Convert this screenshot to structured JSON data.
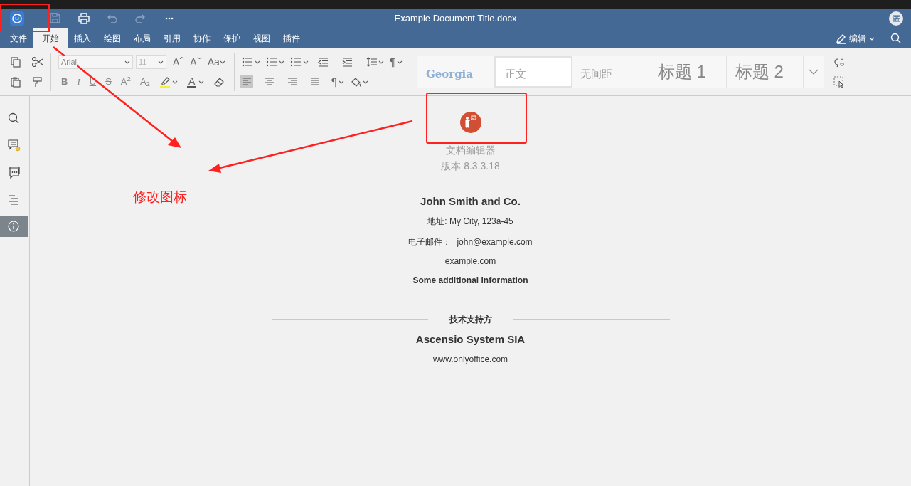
{
  "window": {
    "title": "Example Document Title.docx",
    "avatar": "匿"
  },
  "tabs": [
    {
      "label": "文件",
      "selected": false
    },
    {
      "label": "开始",
      "selected": true
    },
    {
      "label": "插入",
      "selected": false
    },
    {
      "label": "绘图",
      "selected": false
    },
    {
      "label": "布局",
      "selected": false
    },
    {
      "label": "引用",
      "selected": false
    },
    {
      "label": "协作",
      "selected": false
    },
    {
      "label": "保护",
      "selected": false
    },
    {
      "label": "视图",
      "selected": false
    },
    {
      "label": "插件",
      "selected": false
    }
  ],
  "edit_mode": {
    "label": "编辑"
  },
  "toolbar": {
    "font_name": {
      "value": "Arial"
    },
    "font_size": {
      "value": "11"
    },
    "case_buttons": [
      {
        "label": "A",
        "kind": "grow"
      },
      {
        "label": "A",
        "kind": "shrink"
      },
      {
        "label": "Aa",
        "kind": "case"
      }
    ],
    "format_buttons": [
      {
        "label": "B",
        "kind": "bold"
      },
      {
        "label": "I",
        "kind": "italic"
      },
      {
        "label": "U",
        "kind": "underline"
      },
      {
        "label": "S",
        "kind": "strike"
      },
      {
        "label": "A$^{2}$",
        "kind": "plain"
      },
      {
        "label": "A$_{2}$",
        "kind": "plain"
      }
    ],
    "font_color": {
      "label": "A"
    },
    "pilcrows": [
      {
        "label": "¶"
      },
      {
        "label": "¶"
      }
    ],
    "styles": [
      {
        "label": "Georgia",
        "selected": false,
        "kind": "serif"
      },
      {
        "label": "正文",
        "selected": true,
        "kind": "normal"
      },
      {
        "label": "无间距",
        "selected": false,
        "kind": "normal"
      },
      {
        "label": "标题 1",
        "selected": false,
        "kind": "heading"
      },
      {
        "label": "标题 2",
        "selected": false,
        "kind": "heading"
      }
    ]
  },
  "sidebar": {
    "items": [
      {
        "kind": "search",
        "selected": false
      },
      {
        "kind": "comments",
        "selected": false
      },
      {
        "kind": "chat",
        "selected": false
      },
      {
        "kind": "navigation",
        "selected": false
      },
      {
        "kind": "about",
        "selected": true
      }
    ]
  },
  "about": {
    "product": "文档编辑器",
    "version": "版本 8.3.3.18",
    "company": "John Smith and Co.",
    "address": "地址: My City, 123a-45",
    "email_label": "电子邮件：",
    "email": "john@example.com",
    "site": "example.com",
    "info": "Some additional information",
    "support_label": "技术支持方",
    "vendor": "Ascensio System SIA",
    "vendor_site": "www.onlyoffice.com"
  },
  "annotation": {
    "label": "修改图标"
  }
}
